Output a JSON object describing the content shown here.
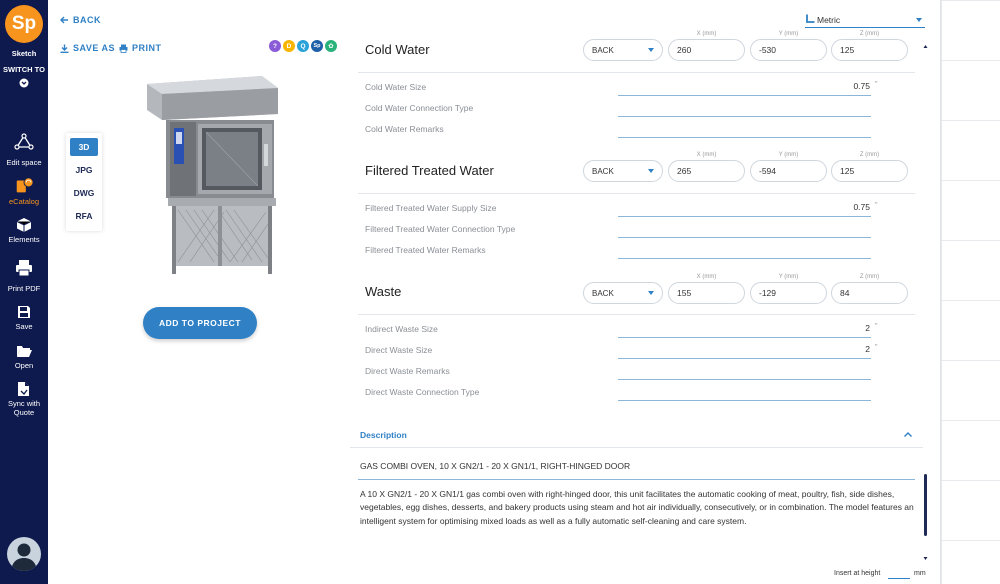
{
  "sidebar": {
    "logo": "Sp",
    "app_name": "Sketch",
    "switch_to": "SWITCH TO",
    "items": [
      {
        "label": "Edit space",
        "icon": "vector-nodes-icon"
      },
      {
        "label": "eCatalog",
        "icon": "catalog-book-icon"
      },
      {
        "label": "Elements",
        "icon": "cube-icon"
      },
      {
        "label": "Print PDF",
        "icon": "printer-icon"
      },
      {
        "label": "Save",
        "icon": "floppy-disk-icon"
      },
      {
        "label": "Open",
        "icon": "folder-open-icon"
      },
      {
        "label": "Sync with",
        "label2": "Quote",
        "icon": "document-sync-icon"
      }
    ]
  },
  "left_panel": {
    "back": "BACK",
    "save_as": "SAVE AS",
    "print": "PRINT",
    "badges": [
      "?",
      "D",
      "Q",
      "Sp",
      "✿"
    ],
    "badge_colors": [
      "#8a5bd6",
      "#f7b500",
      "#29a3d9",
      "#1e5fa8",
      "#2ab27b"
    ],
    "formats": [
      "3D",
      "JPG",
      "DWG",
      "RFA"
    ],
    "active_format": "3D",
    "add_button": "ADD TO PROJECT"
  },
  "units": {
    "selected": "Metric"
  },
  "sections": [
    {
      "title": "Cold Water",
      "side": "BACK",
      "x_label": "X (mm)",
      "y_label": "Y (mm)",
      "z_label": "Z (mm)",
      "x": "260",
      "y": "-530",
      "z": "125",
      "rows": [
        {
          "label": "Cold Water Size",
          "value": "0.75",
          "unit": "\""
        },
        {
          "label": "Cold Water Connection Type",
          "value": "",
          "unit": ""
        },
        {
          "label": "Cold Water Remarks",
          "value": "",
          "unit": ""
        }
      ]
    },
    {
      "title": "Filtered Treated Water",
      "side": "BACK",
      "x_label": "X (mm)",
      "y_label": "Y (mm)",
      "z_label": "Z (mm)",
      "x": "265",
      "y": "-594",
      "z": "125",
      "rows": [
        {
          "label": "Filtered Treated Water Supply Size",
          "value": "0.75",
          "unit": "\""
        },
        {
          "label": "Filtered Treated Water Connection Type",
          "value": "",
          "unit": ""
        },
        {
          "label": "Filtered Treated Water Remarks",
          "value": "",
          "unit": ""
        }
      ]
    },
    {
      "title": "Waste",
      "side": "BACK",
      "x_label": "X (mm)",
      "y_label": "Y (mm)",
      "z_label": "Z (mm)",
      "x": "155",
      "y": "-129",
      "z": "84",
      "rows": [
        {
          "label": "Indirect Waste Size",
          "value": "2",
          "unit": "\""
        },
        {
          "label": "Direct Waste Size",
          "value": "2",
          "unit": "\""
        },
        {
          "label": "Direct Waste Remarks",
          "value": "",
          "unit": ""
        },
        {
          "label": "Direct Waste Connection Type",
          "value": "",
          "unit": ""
        }
      ]
    }
  ],
  "description": {
    "header": "Description",
    "short": "GAS COMBI OVEN, 10 X GN2/1 - 20 X GN1/1, RIGHT-HINGED DOOR",
    "long": "A 10 X GN2/1 - 20 X GN1/1 gas combi oven with right-hinged door, this unit facilitates the automatic cooking of meat, poultry, fish, side dishes, vegetables, egg dishes, desserts, and bakery products using steam and hot air individually, consecutively, or in combination. The model features an intelligent system for optimising mixed loads as well as a fully automatic self-cleaning and care system."
  },
  "footer": {
    "insert_label": "Insert at height",
    "insert_unit": "mm"
  },
  "colors": {
    "accent": "#2f80c5",
    "sidebar": "#0e1a4d",
    "logo": "#f7941d"
  }
}
